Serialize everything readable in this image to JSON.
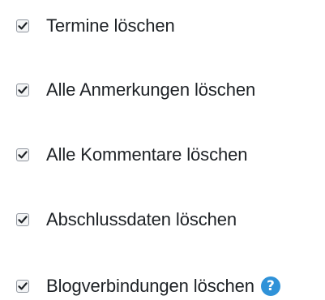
{
  "options": [
    {
      "label": "Termine löschen",
      "checked": true
    },
    {
      "label": "Alle Anmerkungen löschen",
      "checked": true
    },
    {
      "label": "Alle Kommentare löschen",
      "checked": true
    },
    {
      "label": "Abschlussdaten löschen",
      "checked": true
    },
    {
      "label": "Blogverbindungen löschen",
      "checked": true,
      "help_icon": "question-circle-icon"
    }
  ],
  "colors": {
    "text": "#1d2125",
    "checkbox_border": "#8f959e",
    "checkmark": "#1d2125",
    "help_icon_bg": "#2f92d8"
  },
  "help_icon_glyph": "?"
}
